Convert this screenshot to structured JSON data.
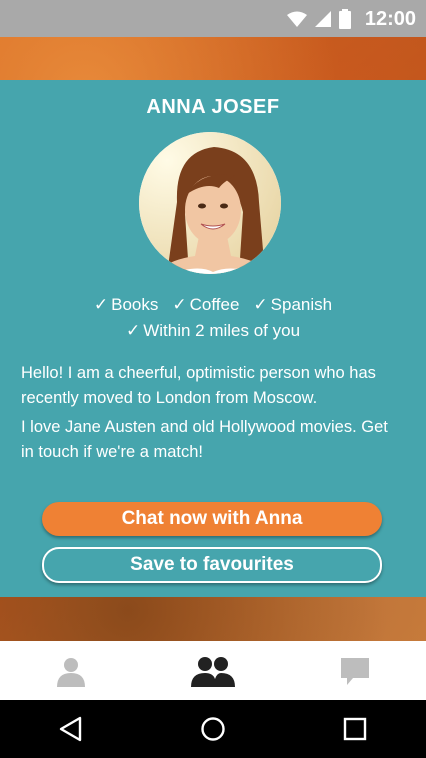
{
  "status_bar": {
    "time": "12:00"
  },
  "profile": {
    "name": "ANNA JOSEF",
    "tags_row1": [
      "Books",
      "Coffee",
      "Spanish"
    ],
    "tags_row2": [
      "Within 2 miles of you"
    ],
    "bio": [
      "Hello! I am a cheerful, optimistic person who has recently moved to London from Moscow.",
      "I love Jane Austen and old Hollywood movies. Get in touch if we're a match!"
    ]
  },
  "actions": {
    "chat_label": "Chat now with Anna",
    "save_label": "Save to favourites"
  },
  "bottom_tabs": [
    {
      "icon": "profile-icon",
      "active": false
    },
    {
      "icon": "people-icon",
      "active": true
    },
    {
      "icon": "chat-bubble-icon",
      "active": false
    }
  ],
  "colors": {
    "card": "#46a5ad",
    "accent": "#ef8134",
    "text": "#ffffff"
  }
}
